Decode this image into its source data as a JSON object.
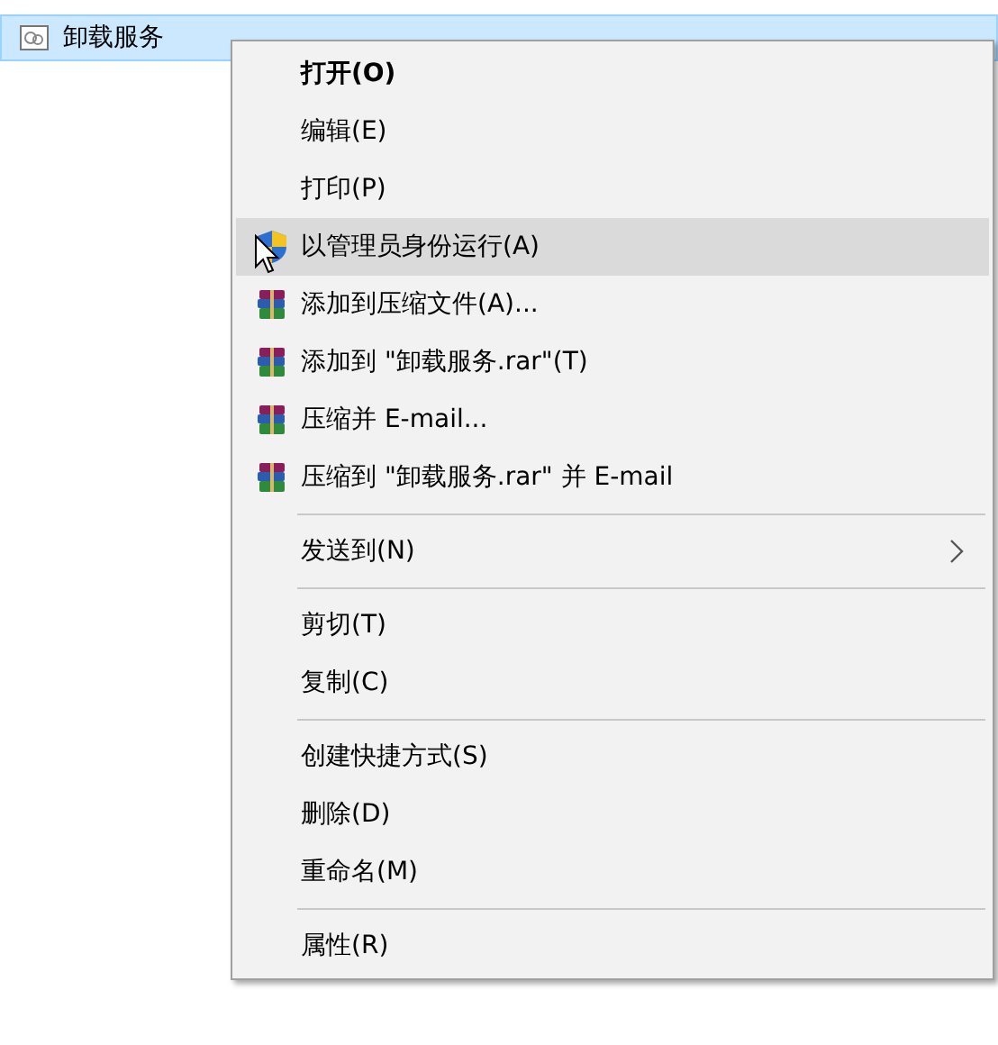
{
  "file": {
    "name": "卸载服务",
    "selected": true
  },
  "menu": [
    {
      "kind": "item",
      "label": "打开(O)",
      "bold": true,
      "selected": false,
      "submenu": false
    },
    {
      "kind": "item",
      "label": "编辑(E)",
      "bold": false,
      "selected": false,
      "submenu": false
    },
    {
      "kind": "item",
      "label": "打印(P)",
      "bold": false,
      "selected": false,
      "submenu": false
    },
    {
      "kind": "admin",
      "label": "以管理员身份运行(A)",
      "bold": false,
      "selected": true,
      "submenu": false
    },
    {
      "kind": "archive",
      "label": "添加到压缩文件(A)...",
      "bold": false,
      "selected": false,
      "submenu": false
    },
    {
      "kind": "archive",
      "label": "添加到 \"卸载服务.rar\"(T)",
      "bold": false,
      "selected": false,
      "submenu": false
    },
    {
      "kind": "archive",
      "label": "压缩并 E-mail...",
      "bold": false,
      "selected": false,
      "submenu": false
    },
    {
      "kind": "archive",
      "label": "压缩到 \"卸载服务.rar\" 并 E-mail",
      "bold": false,
      "selected": false,
      "submenu": false
    },
    {
      "kind": "separator"
    },
    {
      "kind": "item",
      "label": "发送到(N)",
      "bold": false,
      "selected": false,
      "submenu": true
    },
    {
      "kind": "separator"
    },
    {
      "kind": "item",
      "label": "剪切(T)",
      "bold": false,
      "selected": false,
      "submenu": false
    },
    {
      "kind": "item",
      "label": "复制(C)",
      "bold": false,
      "selected": false,
      "submenu": false
    },
    {
      "kind": "separator"
    },
    {
      "kind": "item",
      "label": "创建快捷方式(S)",
      "bold": false,
      "selected": false,
      "submenu": false
    },
    {
      "kind": "item",
      "label": "删除(D)",
      "bold": false,
      "selected": false,
      "submenu": false
    },
    {
      "kind": "item",
      "label": "重命名(M)",
      "bold": false,
      "selected": false,
      "submenu": false
    },
    {
      "kind": "separator"
    },
    {
      "kind": "item",
      "label": "属性(R)",
      "bold": false,
      "selected": false,
      "submenu": false
    }
  ]
}
